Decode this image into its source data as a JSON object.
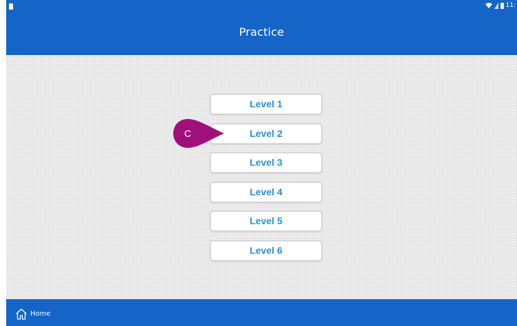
{
  "status_bar": {
    "time": "11:"
  },
  "header": {
    "title": "Practice"
  },
  "levels": [
    {
      "label": "Level 1"
    },
    {
      "label": "Level 2"
    },
    {
      "label": "Level 3"
    },
    {
      "label": "Level 4"
    },
    {
      "label": "Level 5"
    },
    {
      "label": "Level 6"
    }
  ],
  "callout": {
    "letter": "C",
    "color": "#a0107a"
  },
  "footer": {
    "home_label": "Home",
    "home_icon": "home-icon"
  },
  "colors": {
    "primary": "#1565c8",
    "button_text": "#2a8fd0"
  }
}
